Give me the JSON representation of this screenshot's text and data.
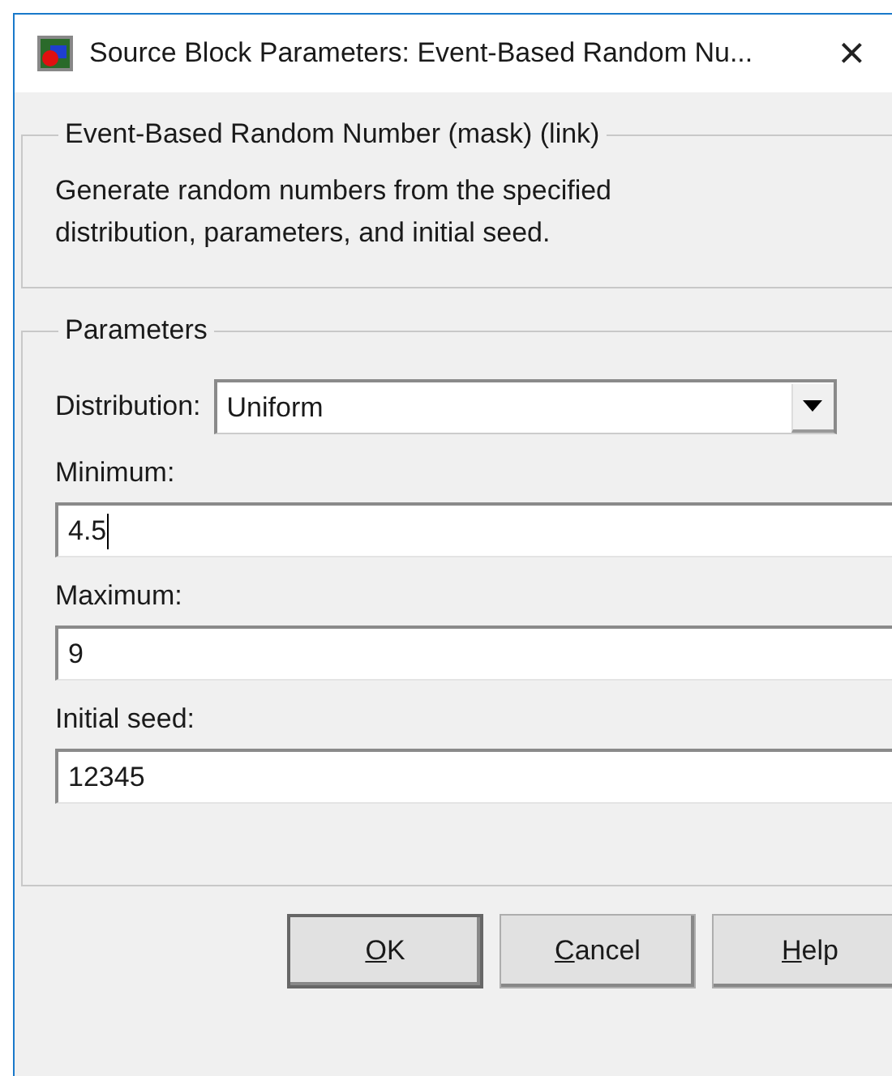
{
  "window": {
    "title": "Source Block Parameters: Event-Based Random Nu...",
    "close": "×"
  },
  "description_group": {
    "legend": "Event-Based Random Number (mask) (link)",
    "text": "Generate random numbers from the specified distribution, parameters, and initial seed."
  },
  "parameters_group": {
    "legend": "Parameters",
    "fields": [
      {
        "kind": "dropdown",
        "label": "Distribution:",
        "value": "Uniform",
        "focused": false
      },
      {
        "kind": "text",
        "label": "Minimum:",
        "value": "4.5",
        "focused": true
      },
      {
        "kind": "text",
        "label": "Maximum:",
        "value": "9",
        "focused": false
      },
      {
        "kind": "text",
        "label": "Initial seed:",
        "value": "12345",
        "focused": false
      }
    ]
  },
  "buttons": [
    {
      "access_key": "O",
      "label_rest": "K",
      "default": true
    },
    {
      "access_key": "C",
      "label_rest": "ancel",
      "default": false
    },
    {
      "access_key": "H",
      "label_rest": "elp",
      "default": false
    }
  ]
}
